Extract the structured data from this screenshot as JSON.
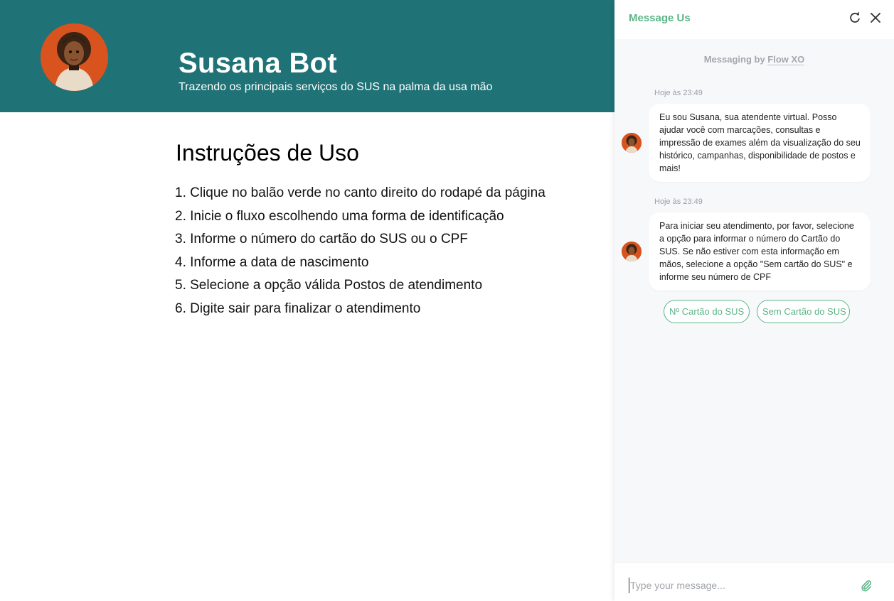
{
  "hero": {
    "title": "Susana Bot",
    "subtitle": "Trazendo os principais serviços do SUS na palma da usa mão"
  },
  "instructions": {
    "title": "Instruções de Uso",
    "items": [
      "1. Clique no balão verde no canto direito do rodapé da página",
      "2. Inicie o fluxo escolhendo uma forma de identificação",
      "3. Informe o número do cartão do SUS ou o CPF",
      "4. Informe a data de nascimento",
      "5. Selecione a opção válida Postos de atendimento",
      "6. Digite sair para finalizar o atendimento"
    ]
  },
  "chat": {
    "title": "Message Us",
    "powered_prefix": "Messaging by ",
    "powered_brand": "Flow XO",
    "messages": [
      {
        "timestamp": "Hoje às 23:49",
        "text": "Eu sou Susana, sua atendente virtual. Posso ajudar você com marcações, consultas e impressão de exames além da visualização do seu histórico, campanhas, disponibilidade de postos e mais!"
      },
      {
        "timestamp": "Hoje às 23:49",
        "text": "Para iniciar seu atendimento, por favor, selecione a opção para informar o número do Cartão do SUS. Se não estiver com esta informação em mãos, selecione a opção \"Sem cartão do SUS\" e informe seu número de CPF"
      }
    ],
    "quick_replies": [
      "Nº Cartão do SUS",
      "Sem Cartão do SUS"
    ],
    "composer_placeholder": "Type your message..."
  },
  "colors": {
    "hero_bg": "#1f7276",
    "accent": "#5cb487",
    "chat_bg": "#f7f8fa"
  },
  "icons": [
    "avatar",
    "refresh-icon",
    "close-icon",
    "paperclip-icon"
  ]
}
